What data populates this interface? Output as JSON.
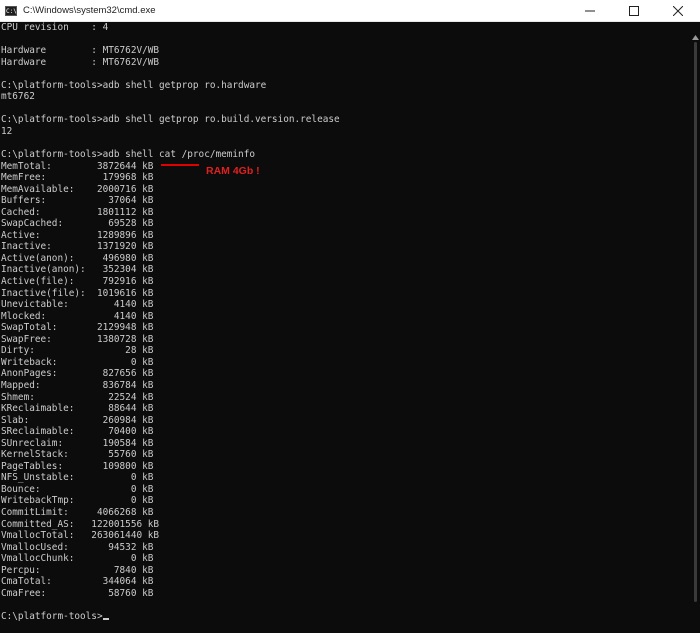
{
  "window": {
    "title": "C:\\Windows\\system32\\cmd.exe",
    "icon_label": "C:\\"
  },
  "terminal": {
    "lines": [
      "CPU revision    : 4",
      "",
      "Hardware        : MT6762V/WB",
      "Hardware        : MT6762V/WB",
      "",
      "C:\\platform-tools>adb shell getprop ro.hardware",
      "mt6762",
      "",
      "C:\\platform-tools>adb shell getprop ro.build.version.release",
      "12",
      "",
      "C:\\platform-tools>adb shell cat /proc/meminfo",
      "MemTotal:        3872644 kB",
      "MemFree:          179968 kB",
      "MemAvailable:    2000716 kB",
      "Buffers:           37064 kB",
      "Cached:          1801112 kB",
      "SwapCached:        69528 kB",
      "Active:          1289896 kB",
      "Inactive:        1371920 kB",
      "Active(anon):     496980 kB",
      "Inactive(anon):   352304 kB",
      "Active(file):     792916 kB",
      "Inactive(file):  1019616 kB",
      "Unevictable:        4140 kB",
      "Mlocked:            4140 kB",
      "SwapTotal:       2129948 kB",
      "SwapFree:        1380728 kB",
      "Dirty:                28 kB",
      "Writeback:             0 kB",
      "AnonPages:        827656 kB",
      "Mapped:           836784 kB",
      "Shmem:             22524 kB",
      "KReclaimable:      88644 kB",
      "Slab:             260984 kB",
      "SReclaimable:      70400 kB",
      "SUnreclaim:       190584 kB",
      "KernelStack:       55760 kB",
      "PageTables:       109800 kB",
      "NFS_Unstable:          0 kB",
      "Bounce:                0 kB",
      "WritebackTmp:          0 kB",
      "CommitLimit:     4066268 kB",
      "Committed_AS:   122001556 kB",
      "VmallocTotal:   263061440 kB",
      "VmallocUsed:       94532 kB",
      "VmallocChunk:          0 kB",
      "Percpu:             7840 kB",
      "CmaTotal:         344064 kB",
      "CmaFree:           58760 kB",
      "",
      "C:\\platform-tools>"
    ]
  },
  "annotation": {
    "text": "RAM 4Gb !",
    "color": "#e02020"
  },
  "colors": {
    "terminal_bg": "#0c0c0c",
    "terminal_fg": "#cccccc",
    "titlebar_bg": "#ffffff"
  },
  "icons": {
    "minimize": "minimize-icon",
    "maximize": "maximize-icon",
    "close": "close-icon",
    "scroll_up": "chevron-up-icon"
  }
}
